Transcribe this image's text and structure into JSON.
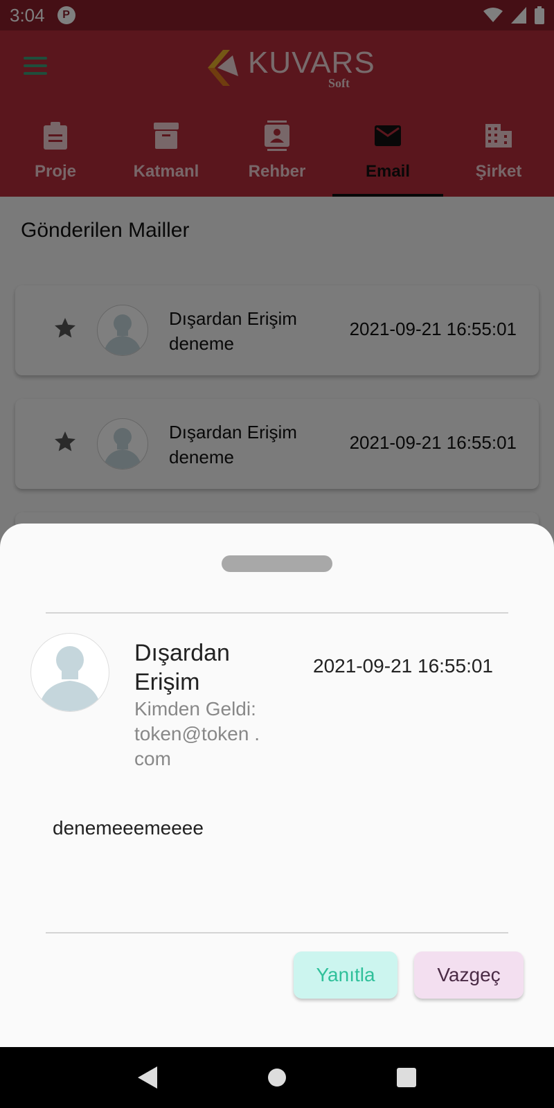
{
  "status_bar": {
    "time": "3:04",
    "app_badge": "P"
  },
  "app_bar": {
    "logo": {
      "word": "KUVARS",
      "sub": "Soft"
    },
    "tabs": [
      {
        "label": "Proje",
        "icon": "clipboard-icon",
        "active": false
      },
      {
        "label": "Katmanl",
        "icon": "archive-icon",
        "active": false
      },
      {
        "label": "Rehber",
        "icon": "contacts-icon",
        "active": false
      },
      {
        "label": "Email",
        "icon": "mail-icon",
        "active": true
      },
      {
        "label": "Şirket",
        "icon": "building-icon",
        "active": false
      }
    ]
  },
  "main": {
    "title": "Gönderilen Mailler",
    "mails": [
      {
        "subject": "Dışardan Erişim deneme",
        "date": "2021-09-21 16:55:01"
      },
      {
        "subject": "Dışardan Erişim deneme",
        "date": "2021-09-21 16:55:01"
      }
    ]
  },
  "sheet": {
    "sender_name": "Dışardan Erişim",
    "from": "Kimden Geldi: token@token .com",
    "date": "2021-09-21 16:55:01",
    "body": "denemeeemeeee",
    "reply_label": "Yanıtla",
    "cancel_label": "Vazgeç"
  },
  "colors": {
    "app_bar": "#b42d3a",
    "status_bar": "#8a1f2a",
    "reply_bg": "#ccf5ef",
    "reply_text": "#2fc09a",
    "cancel_bg": "#f3dff0",
    "cancel_text": "#4a2b45"
  }
}
